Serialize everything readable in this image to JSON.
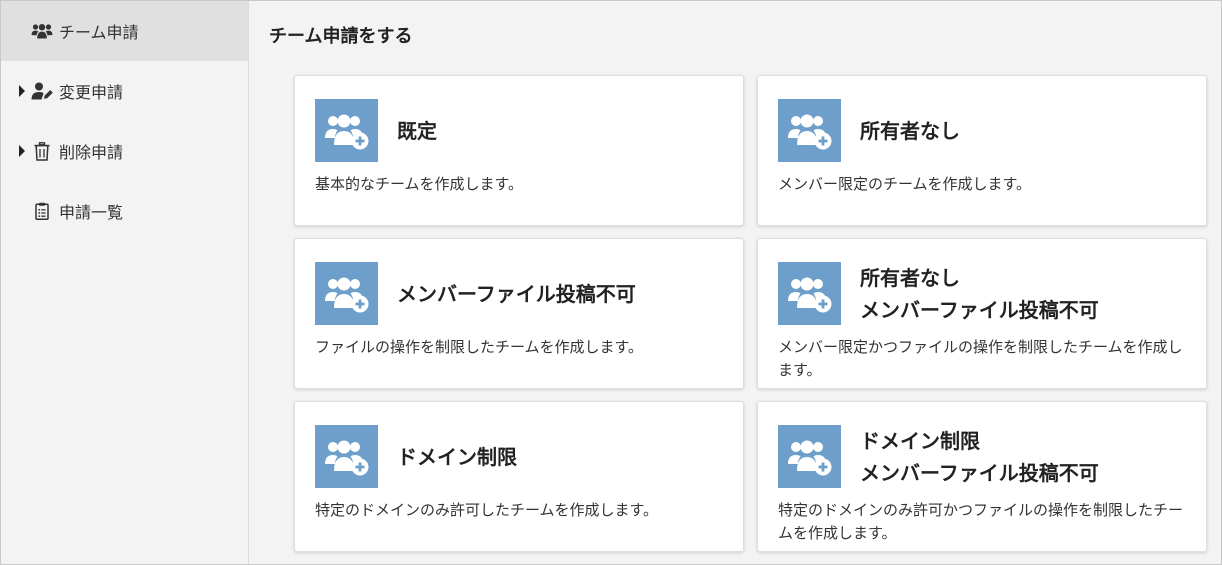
{
  "sidebar": {
    "items": [
      {
        "label": "チーム申請",
        "icon": "team-icon",
        "active": true,
        "expandable": false
      },
      {
        "label": "変更申請",
        "icon": "user-edit-icon",
        "active": false,
        "expandable": true
      },
      {
        "label": "削除申請",
        "icon": "trash-icon",
        "active": false,
        "expandable": true
      },
      {
        "label": "申請一覧",
        "icon": "clipboard-list-icon",
        "active": false,
        "expandable": false
      }
    ]
  },
  "main": {
    "title": "チーム申請をする",
    "cards": [
      {
        "title": [
          "既定"
        ],
        "desc": "基本的なチームを作成します。",
        "icon": "team-add-icon"
      },
      {
        "title": [
          "所有者なし"
        ],
        "desc": "メンバー限定のチームを作成します。",
        "icon": "team-add-icon"
      },
      {
        "title": [
          "メンバーファイル投稿不可"
        ],
        "desc": "ファイルの操作を制限したチームを作成します。",
        "icon": "team-add-icon"
      },
      {
        "title": [
          "所有者なし",
          "メンバーファイル投稿不可"
        ],
        "desc": "メンバー限定かつファイルの操作を制限したチームを作成します。",
        "icon": "team-add-icon"
      },
      {
        "title": [
          "ドメイン制限"
        ],
        "desc": "特定のドメインのみ許可したチームを作成します。",
        "icon": "team-add-icon"
      },
      {
        "title": [
          "ドメイン制限",
          "メンバーファイル投稿不可"
        ],
        "desc": "特定のドメインのみ許可かつファイルの操作を制限したチームを作成します。",
        "icon": "team-add-icon"
      }
    ]
  },
  "colors": {
    "thumb": "#6e9fca",
    "sidebar_active": "#e0e0e0",
    "background": "#f3f3f3"
  }
}
